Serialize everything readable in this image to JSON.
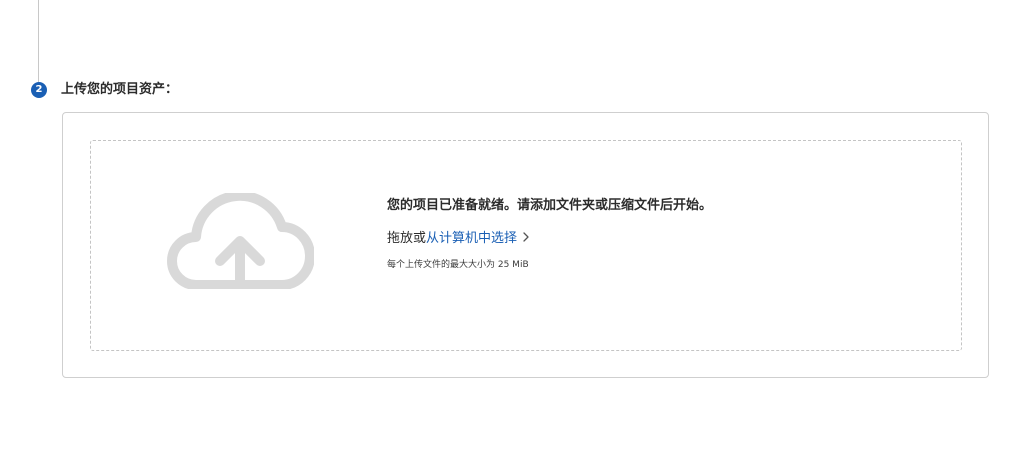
{
  "step": {
    "number": "2",
    "title": "上传您的项目资产："
  },
  "upload": {
    "ready_text": "您的项目已准备就绪。请添加文件夹或压缩文件后开始。",
    "drag_text": "拖放或",
    "choose_link": "从计算机中选择",
    "limit_text": "每个上传文件的最大大小为 25 MiB"
  },
  "icons": {
    "upload": "cloud-upload-icon",
    "chevron": "chevron-right-icon"
  },
  "colors": {
    "accent": "#1a5fb4",
    "icon_gray": "#d9d9d9",
    "border": "#cfcfcf"
  }
}
